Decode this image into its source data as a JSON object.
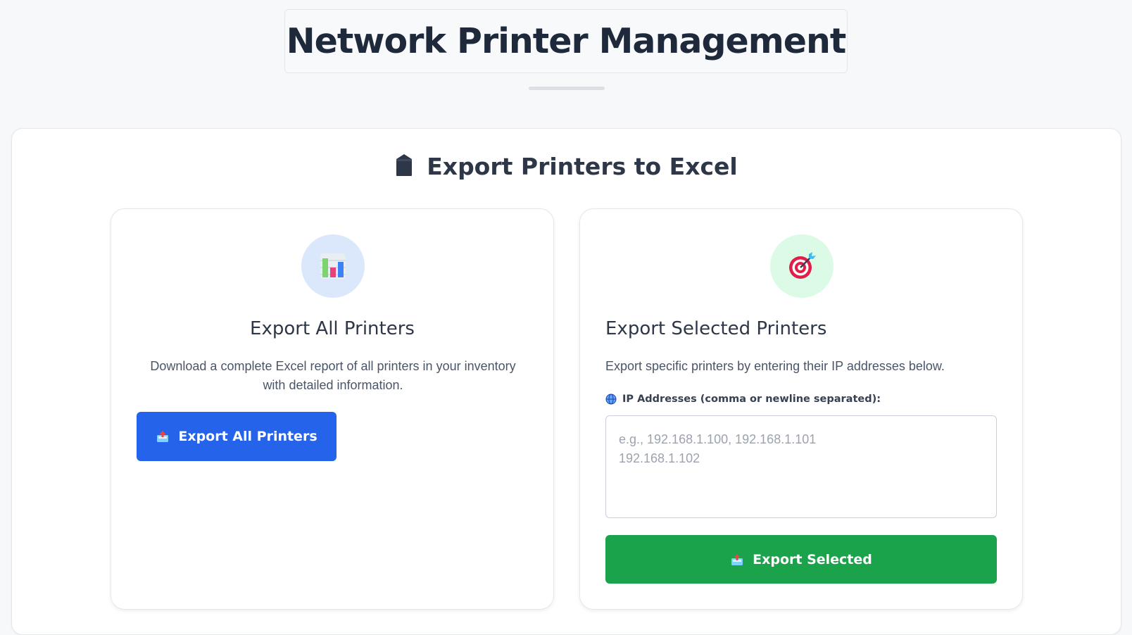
{
  "header": {
    "title": "Network Printer Management"
  },
  "export_section": {
    "title": "Export Printers to Excel",
    "icon": "package-icon"
  },
  "export_all": {
    "icon": "bar-chart-icon",
    "title": "Export All Printers",
    "description": "Download a complete Excel report of all printers in your inventory with detailed information.",
    "button_label": "Export All Printers",
    "button_icon": "outbox-tray-icon"
  },
  "export_selected": {
    "icon": "target-icon",
    "title": "Export Selected Printers",
    "description": "Export specific printers by entering their IP addresses below.",
    "field_label": "IP Addresses (comma or newline separated):",
    "field_icon": "globe-icon",
    "field_value": "",
    "field_placeholder": "e.g., 192.168.1.100, 192.168.1.101\n192.168.1.102",
    "button_label": "Export Selected",
    "button_icon": "outbox-tray-icon"
  },
  "colors": {
    "primary_blue": "#2563eb",
    "success_green": "#1ba34c",
    "page_bg": "#f7f8fa",
    "heading": "#1e293b"
  }
}
